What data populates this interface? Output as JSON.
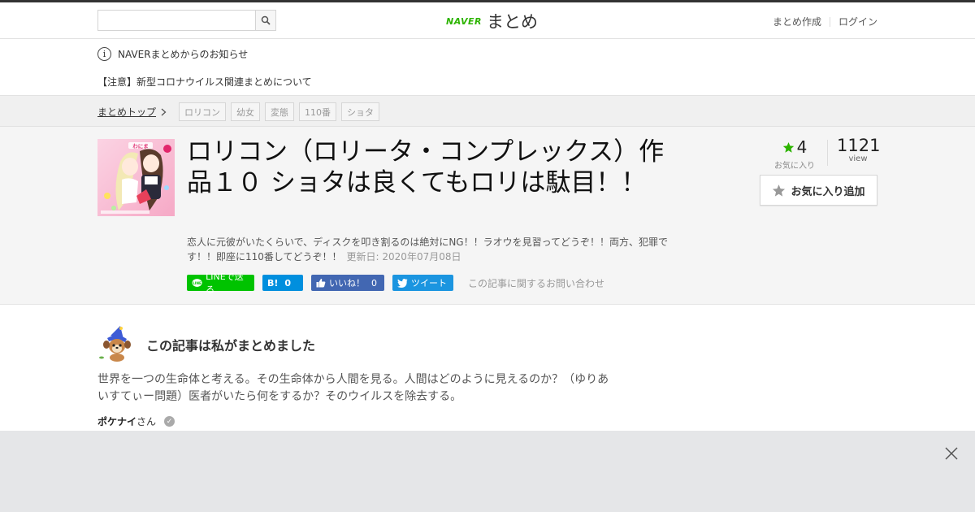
{
  "header": {
    "search_placeholder": "",
    "logo_brand": "NAVER",
    "logo_text": "まとめ",
    "nav": [
      "まとめ作成",
      "ログイン"
    ]
  },
  "notice": {
    "title": "NAVERまとめからのお知らせ",
    "item": "【注意】新型コロナウイルス関連まとめについて"
  },
  "breadcrumb": {
    "top": "まとめトップ",
    "tags": [
      "ロリコン",
      "幼女",
      "変態",
      "110番",
      "ショタ"
    ]
  },
  "article": {
    "title": "ロリコン（ロリータ・コンプレックス）作品１０ ショタは良くてもロリは駄目！！",
    "description": "恋人に元彼がいたくらいで、ディスクを叩き割るのは絶対にNG！！ラオウを見習ってどうぞ！！両方、犯罪です！！即座に110番してどうぞ！！",
    "updated": "更新日: 2020年07月08日",
    "thumb_caption": "わにま"
  },
  "share": {
    "line": "LINEで送る",
    "hatena_label": "B!",
    "hatena_count": "0",
    "facebook_label": "いいね！",
    "facebook_count": "0",
    "twitter": "ツイート",
    "contact": "この記事に関するお問い合わせ"
  },
  "stats": {
    "favorites": "4",
    "favorites_label": "お気に入り",
    "views": "1121",
    "views_label": "view",
    "add_favorite": "お気に入り追加"
  },
  "author": {
    "heading": "この記事は私がまとめました",
    "bio": "世界を一つの生命体と考える。その生命体から人間を見る。人間はどのように見えるのか？（ゆりあいすてぃー問題）医者がいたら何をするか？そのウイルスを除去する。",
    "name": "ポケナイ",
    "suffix": "さん"
  },
  "colors": {
    "line": "#00c300",
    "hatena": "#008fde",
    "facebook": "#4267b2",
    "twitter": "#1b95e0",
    "favorite_star": "#2db400",
    "brand": "#2db400"
  },
  "icons": [
    "search-icon",
    "info-icon",
    "chevron-right-icon",
    "star-icon",
    "close-icon",
    "verified-icon"
  ]
}
